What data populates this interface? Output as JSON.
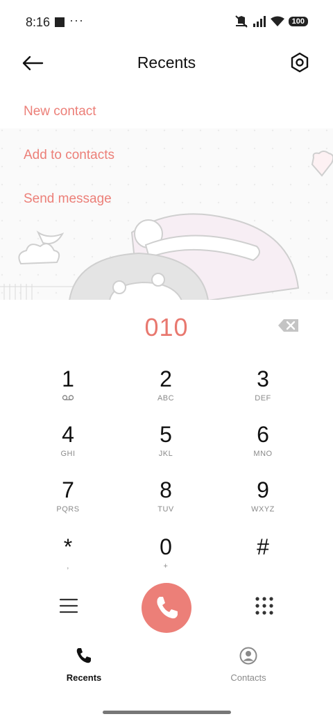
{
  "status_bar": {
    "time": "8:16",
    "dots": "···",
    "battery": "100"
  },
  "header": {
    "title": "Recents"
  },
  "menu": {
    "new_contact": "New contact",
    "add_to_contacts": "Add to contacts",
    "send_message": "Send message"
  },
  "dialer": {
    "number": "010",
    "keys": [
      {
        "digit": "1",
        "sub": ""
      },
      {
        "digit": "2",
        "sub": "ABC"
      },
      {
        "digit": "3",
        "sub": "DEF"
      },
      {
        "digit": "4",
        "sub": "GHI"
      },
      {
        "digit": "5",
        "sub": "JKL"
      },
      {
        "digit": "6",
        "sub": "MNO"
      },
      {
        "digit": "7",
        "sub": "PQRS"
      },
      {
        "digit": "8",
        "sub": "TUV"
      },
      {
        "digit": "9",
        "sub": "WXYZ"
      },
      {
        "digit": "*",
        "sub": ","
      },
      {
        "digit": "0",
        "sub": "+"
      },
      {
        "digit": "#",
        "sub": ""
      }
    ]
  },
  "bottom_nav": {
    "recents": "Recents",
    "contacts": "Contacts"
  },
  "colors": {
    "accent": "#ec7f78",
    "number": "#e8786f"
  }
}
